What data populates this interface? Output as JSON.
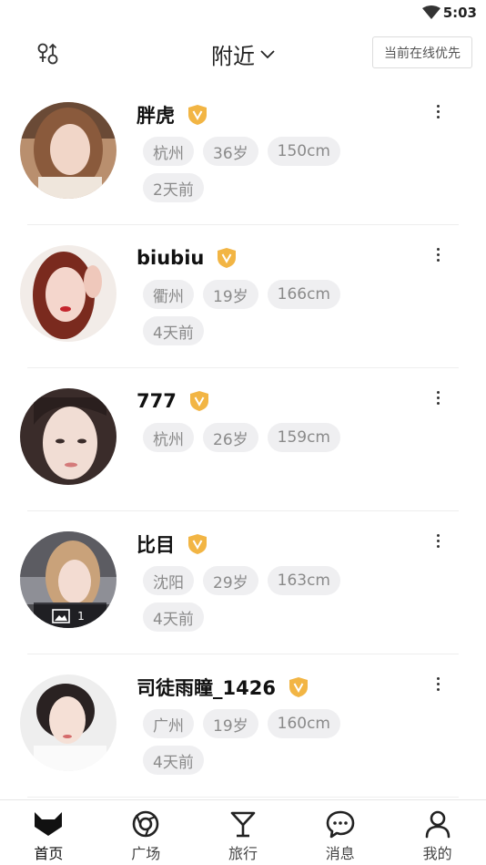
{
  "status_bar": {
    "time": "5:03",
    "icons": [
      "wifi-icon"
    ]
  },
  "header": {
    "title": "附近",
    "online_first_label": "当前在线优先",
    "filter_icon": "gender-filter-icon"
  },
  "users": [
    {
      "name": "胖虎",
      "verified": true,
      "tags": [
        "杭州",
        "36岁",
        "150cm",
        "2天前"
      ],
      "photo_count": null
    },
    {
      "name": "biubiu",
      "verified": true,
      "tags": [
        "衢州",
        "19岁",
        "166cm",
        "4天前"
      ],
      "photo_count": null
    },
    {
      "name": "777",
      "verified": true,
      "tags": [
        "杭州",
        "26岁",
        "159cm"
      ],
      "photo_count": null
    },
    {
      "name": "比目",
      "verified": true,
      "tags": [
        "沈阳",
        "29岁",
        "163cm",
        "4天前"
      ],
      "photo_count": "1"
    },
    {
      "name": "司徒雨瞳_1426",
      "verified": true,
      "tags": [
        "广州",
        "19岁",
        "160cm",
        "4天前"
      ],
      "photo_count": null
    }
  ],
  "tabbar": {
    "items": [
      {
        "label": "首页",
        "icon": "fox-home-icon",
        "active": true
      },
      {
        "label": "广场",
        "icon": "aperture-icon",
        "active": false
      },
      {
        "label": "旅行",
        "icon": "cocktail-glass-icon",
        "active": false
      },
      {
        "label": "消息",
        "icon": "chat-bubble-icon",
        "active": false
      },
      {
        "label": "我的",
        "icon": "person-icon",
        "active": false
      }
    ]
  },
  "colors": {
    "verified_badge": "#f2b544",
    "tag_bg": "#efeff1",
    "tag_text": "#8a8a8a"
  }
}
